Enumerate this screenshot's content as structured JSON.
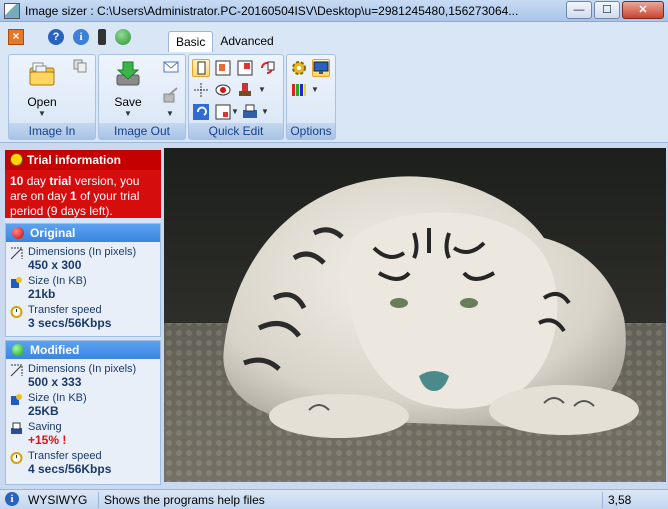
{
  "window": {
    "title": "Image sizer : C:\\Users\\Administrator.PC-20160504ISV\\Desktop\\u=2981245480,156273064...",
    "min_label": "—",
    "max_label": "☐",
    "close_label": "✕"
  },
  "quick_access": {
    "help_label": "?",
    "info_label": "i"
  },
  "ribbon": {
    "tabs": [
      {
        "label": "Basic",
        "active": true
      },
      {
        "label": "Advanced",
        "active": false
      }
    ],
    "groups": {
      "image_in": {
        "label": "Image In",
        "open_label": "Open"
      },
      "image_out": {
        "label": "Image Out",
        "save_label": "Save"
      },
      "quick_edit": {
        "label": "Quick Edit"
      },
      "options": {
        "label": "Options"
      }
    },
    "dropdown_arrow": "▼"
  },
  "trial": {
    "title": "Trial information",
    "days": "10",
    "day_word": " day ",
    "trial_word": "trial",
    "mid": " version, you are on day ",
    "day_num": "1",
    "end": " of your trial period (9 days left)."
  },
  "original": {
    "header": "Original",
    "dimensions_label": "Dimensions (In pixels)",
    "dimensions_value": "450 x 300",
    "size_label": "Size (In KB)",
    "size_value": "21kb",
    "speed_label": "Transfer speed",
    "speed_value": "3 secs/56Kbps"
  },
  "modified": {
    "header": "Modified",
    "dimensions_label": "Dimensions (In pixels)",
    "dimensions_value": "500 x 333",
    "size_label": "Size (In KB)",
    "size_value": "25KB",
    "saving_label": "Saving",
    "saving_value": "+15% !",
    "speed_label": "Transfer speed",
    "speed_value": "4 secs/56Kbps"
  },
  "statusbar": {
    "info_icon": "i",
    "mode": "WYSIWYG",
    "hint": "Shows the programs help files",
    "zoom": "3,58"
  },
  "colors": {
    "trial_red": "#d60d0d",
    "section_blue": "#3a85e0",
    "original_ball": "#d81c1c",
    "modified_ball": "#2fb02f",
    "saving_red": "#e01010"
  }
}
